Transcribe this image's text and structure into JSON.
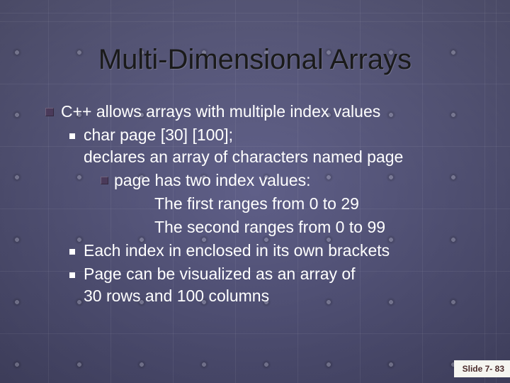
{
  "title": "Multi-Dimensional Arrays",
  "content": {
    "l0": "C++ allows arrays with multiple index values",
    "l1a_line1": "char page [30] [100];",
    "l1a_line2": "declares an array of characters named page",
    "l2": "page has two index values:",
    "l3a": "The first ranges from 0 to 29",
    "l3b": "The second ranges from 0 to 99",
    "l1b": "Each index  in enclosed in its own brackets",
    "l1c_line1": "Page can be visualized as an array of",
    "l1c_line2": "30 rows and 100 columns"
  },
  "footer": {
    "slide_label": "Slide 7- 83"
  }
}
